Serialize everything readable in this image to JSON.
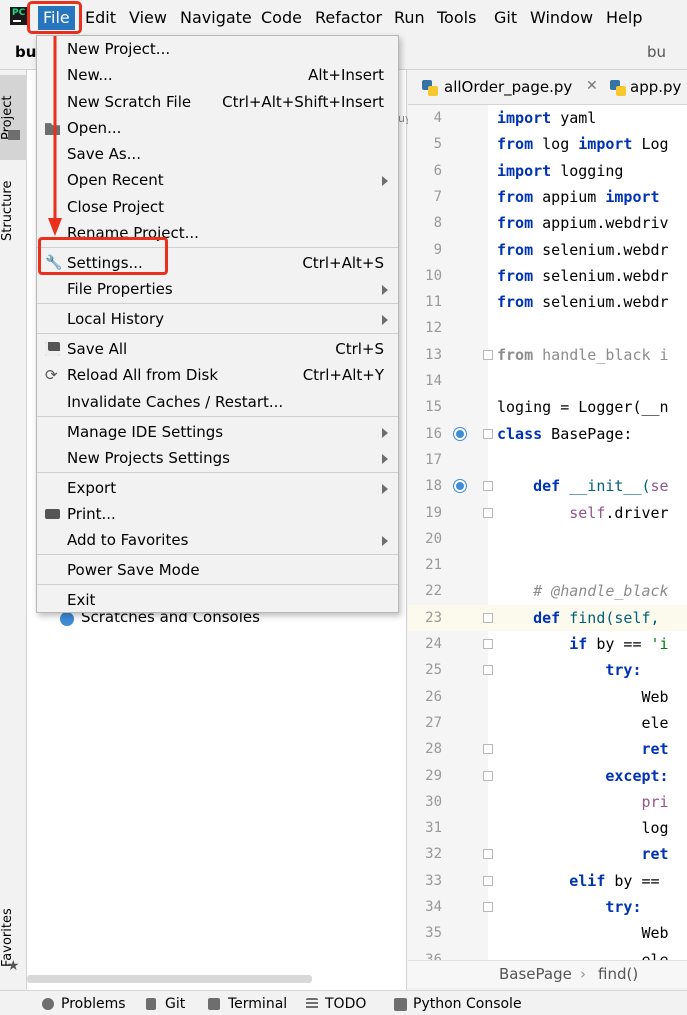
{
  "menubar": {
    "app_icon": "pycharm-logo",
    "items": [
      {
        "label": "File",
        "active": true
      },
      {
        "label": "Edit"
      },
      {
        "label": "View"
      },
      {
        "label": "Navigate"
      },
      {
        "label": "Code"
      },
      {
        "label": "Refactor"
      },
      {
        "label": "Run"
      },
      {
        "label": "Tools"
      },
      {
        "label": "Git"
      },
      {
        "label": "Window"
      },
      {
        "label": "Help"
      }
    ]
  },
  "project_header": {
    "left_text": "bu",
    "right_text": "bu"
  },
  "left_strip": {
    "project": "Project",
    "structure": "Structure",
    "favorites": "Favorites"
  },
  "file_menu": {
    "new_project": "New Project...",
    "new": "New...",
    "new_sc": "Alt+Insert",
    "new_scratch": "New Scratch File",
    "new_scratch_sc": "Ctrl+Alt+Shift+Insert",
    "open": "Open...",
    "save_as": "Save As...",
    "open_recent": "Open Recent",
    "close_project": "Close Project",
    "rename_project": "Rename Project...",
    "settings": "Settings...",
    "settings_sc": "Ctrl+Alt+S",
    "file_properties": "File Properties",
    "local_history": "Local History",
    "save_all": "Save All",
    "save_all_sc": "Ctrl+S",
    "reload": "Reload All from Disk",
    "reload_sc": "Ctrl+Alt+Y",
    "invalidate": "Invalidate Caches / Restart...",
    "manage_ide": "Manage IDE Settings",
    "new_projects_settings": "New Projects Settings",
    "export": "Export",
    "print": "Print...",
    "add_favorites": "Add to Favorites",
    "power_save": "Power Save Mode",
    "exit": "Exit"
  },
  "project_panel": {
    "scratches": "Scratches and Consoles",
    "partial": "uy"
  },
  "editor_tabs": [
    {
      "label": "allOrder_page.py"
    },
    {
      "label": "app.py"
    }
  ],
  "code_lines": [
    {
      "n": "4"
    },
    {
      "n": "5"
    },
    {
      "n": "6"
    },
    {
      "n": "7"
    },
    {
      "n": "8"
    },
    {
      "n": "9"
    },
    {
      "n": "10"
    },
    {
      "n": "11"
    },
    {
      "n": "12"
    },
    {
      "n": "13"
    },
    {
      "n": "14"
    },
    {
      "n": "15"
    },
    {
      "n": "16"
    },
    {
      "n": "17"
    },
    {
      "n": "18"
    },
    {
      "n": "19"
    },
    {
      "n": "20"
    },
    {
      "n": "21"
    },
    {
      "n": "22"
    },
    {
      "n": "23"
    },
    {
      "n": "24"
    },
    {
      "n": "25"
    },
    {
      "n": "26"
    },
    {
      "n": "27"
    },
    {
      "n": "28"
    },
    {
      "n": "29"
    },
    {
      "n": "30"
    },
    {
      "n": "31"
    },
    {
      "n": "32"
    },
    {
      "n": "33"
    },
    {
      "n": "34"
    },
    {
      "n": "35"
    },
    {
      "n": "36"
    }
  ],
  "code": {
    "l4a": "import",
    "l4b": " yaml",
    "l5a": "from",
    "l5b": " log ",
    "l5c": "import",
    "l5d": " Log",
    "l6a": "import",
    "l6b": " logging",
    "l7a": "from",
    "l7b": " appium ",
    "l7c": "import",
    "l8a": "from",
    "l8b": " appium.webdriv",
    "l9a": "from",
    "l9b": " selenium.webdr",
    "l10a": "from",
    "l10b": " selenium.webdr",
    "l11a": "from",
    "l11b": " selenium.webdr",
    "l13a": "from",
    "l13b": " handle_black i",
    "l15": "loging = Logger(__n",
    "l16a": "class",
    "l16b": " BasePage:",
    "l18a": "    def",
    "l18b": " __init__(",
    "l18c": "se",
    "l19a": "        self",
    "l19b": ".driver",
    "l22": "    # @handle_black",
    "l23a": "    def",
    "l23b": " find(self, ",
    "l24a": "        if",
    "l24b": " by == ",
    "l24c": "'i",
    "l25": "            try:",
    "l26": "                Web",
    "l27": "                ele",
    "l28": "                ret",
    "l29": "            except:",
    "l30": "                pri",
    "l31": "                log",
    "l32": "                ret",
    "l33a": "        elif",
    "l33b": " by ==",
    "l34": "            try:",
    "l35": "                Web",
    "l36": "                ele"
  },
  "breadcrumb": {
    "a": "BasePage",
    "b": "find()"
  },
  "tool_windows": {
    "problems": "Problems",
    "git": "Git",
    "terminal": "Terminal",
    "todo": "TODO",
    "python_console": "Python Console"
  },
  "colors": {
    "highlight_red": "#e8301c",
    "menu_active": "#2675bf",
    "keyword": "#0033b3"
  }
}
